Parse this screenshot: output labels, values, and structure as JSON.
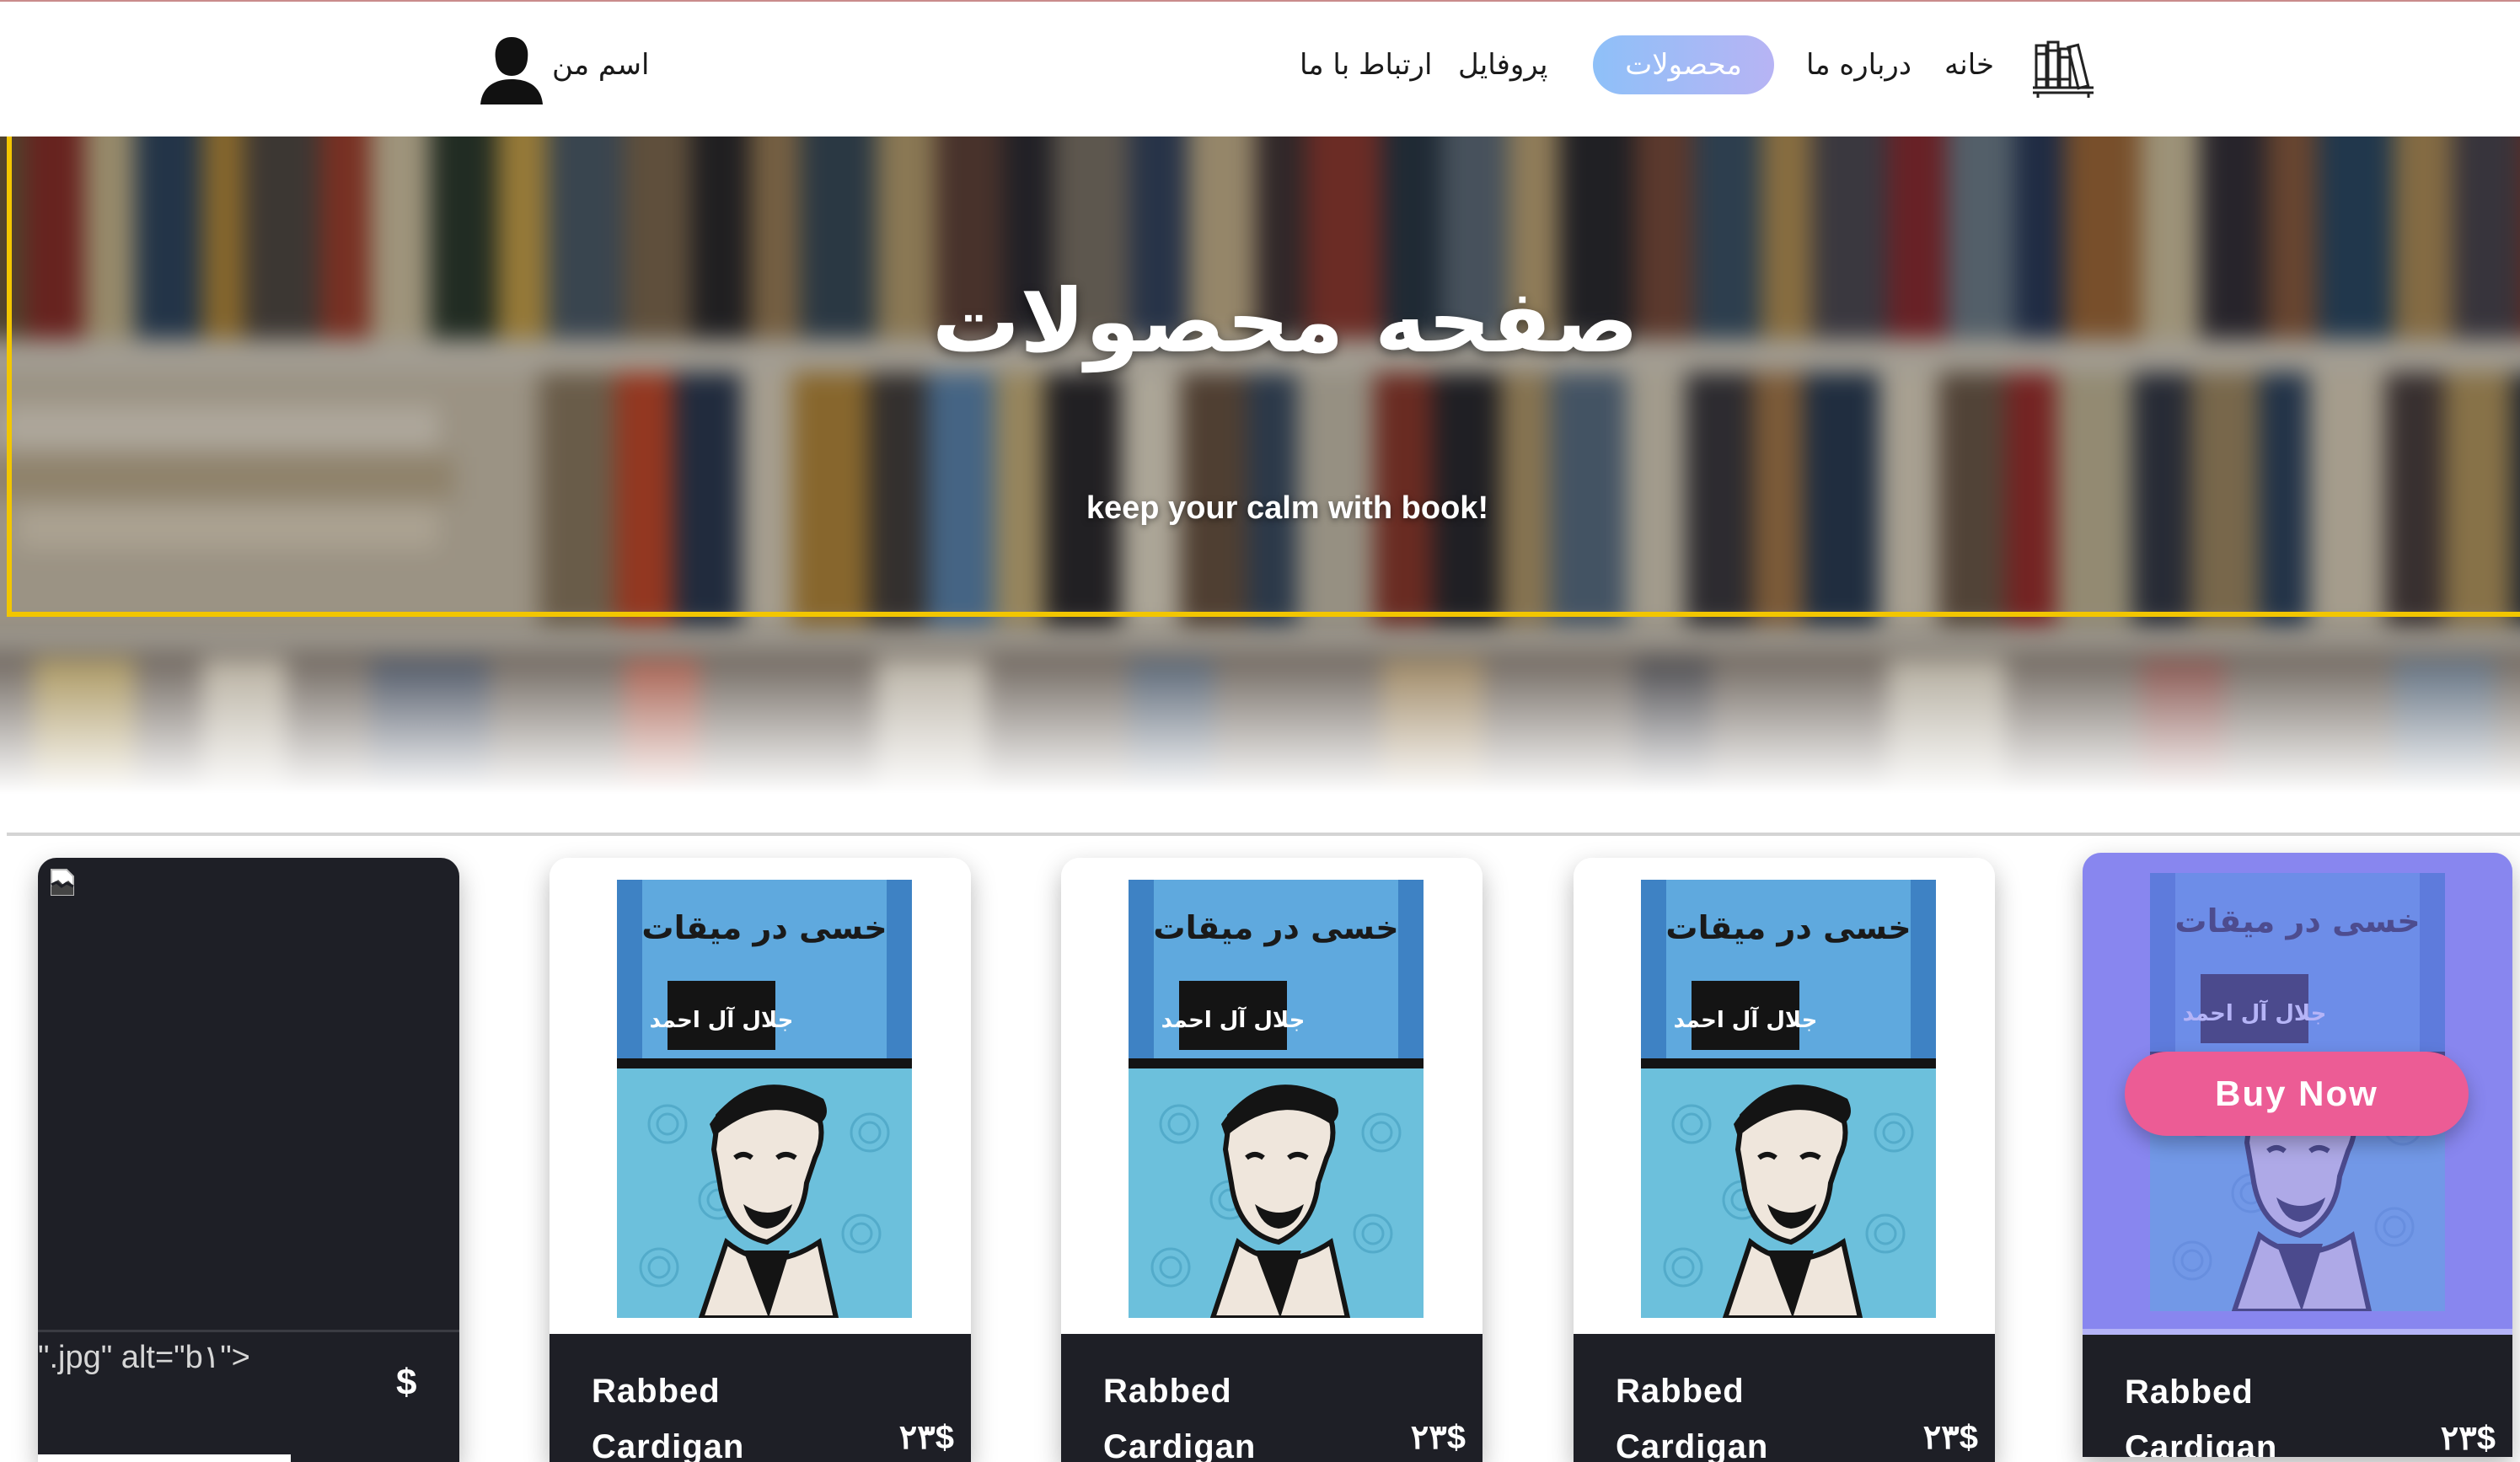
{
  "nav": {
    "home": "خانه",
    "about": "درباره ما",
    "products": "محصولات",
    "profile": "پروفایل",
    "contact": "ارتباط با ما",
    "user_name": "اسم من"
  },
  "hero": {
    "title": "صفحه محصولات",
    "subtitle": "keep your calm with book!"
  },
  "cover": {
    "title": "خسی در میقات",
    "author": "جلال آل احمد"
  },
  "products": [
    {
      "alt_text": "\".jpg\" alt=\"b١\">",
      "price": "$"
    },
    {
      "name": "Rabbed Cardigan",
      "price": "٢٣$"
    },
    {
      "name": "Rabbed Cardigan",
      "price": "٢٣$"
    },
    {
      "name": "Rabbed Cardigan",
      "price": "٢٣$"
    },
    {
      "name": "Rabbed Cardigan",
      "price": "٢٣$",
      "button": "Buy Now"
    }
  ],
  "colors": {
    "accent_gradient_start": "#8ec0f8",
    "accent_gradient_end": "#b7b4f4",
    "hero_border": "#f2c600",
    "card_info_bg": "#1e1f26",
    "buy_button": "#ec5c95",
    "hover_overlay": "#7876f0"
  },
  "icons": {
    "logo": "books-shelf-icon",
    "avatar": "user-silhouette-icon",
    "broken_image": "broken-image-icon"
  }
}
